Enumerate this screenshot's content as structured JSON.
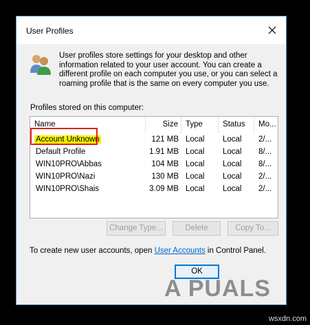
{
  "dialog": {
    "title": "User Profiles",
    "description": "User profiles store settings for your desktop and other information related to your user account. You can create a different profile on each computer you use, or you can select a roaming profile that is the same on every computer you use.",
    "stored_label": "Profiles stored on this computer:"
  },
  "table": {
    "headers": [
      "Name",
      "Size",
      "Type",
      "Status",
      "Mo..."
    ],
    "rows": [
      {
        "name": "Account Unknown",
        "size": "121 MB",
        "type": "Local",
        "status": "Local",
        "mod": "2/..."
      },
      {
        "name": "Default Profile",
        "size": "1.91 MB",
        "type": "Local",
        "status": "Local",
        "mod": "8/..."
      },
      {
        "name": "WIN10PRO\\Abbas",
        "size": "104 MB",
        "type": "Local",
        "status": "Local",
        "mod": "8/..."
      },
      {
        "name": "WIN10PRO\\Nazi",
        "size": "130 MB",
        "type": "Local",
        "status": "Local",
        "mod": "2/..."
      },
      {
        "name": "WIN10PRO\\Shais",
        "size": "3.09 MB",
        "type": "Local",
        "status": "Local",
        "mod": "2/..."
      }
    ]
  },
  "buttons": {
    "change_type": "Change Type...",
    "delete": "Delete",
    "copy_to": "Copy To...",
    "ok": "OK"
  },
  "footer": {
    "prefix": "To create new user accounts, open ",
    "link": "User Accounts",
    "suffix": " in Control Panel."
  },
  "watermark": "A PUALS",
  "site": "wsxdn.com",
  "colors": {
    "highlight_border": "#e0201b",
    "highlight_fill": "#f5f500",
    "link": "#0066cc"
  }
}
